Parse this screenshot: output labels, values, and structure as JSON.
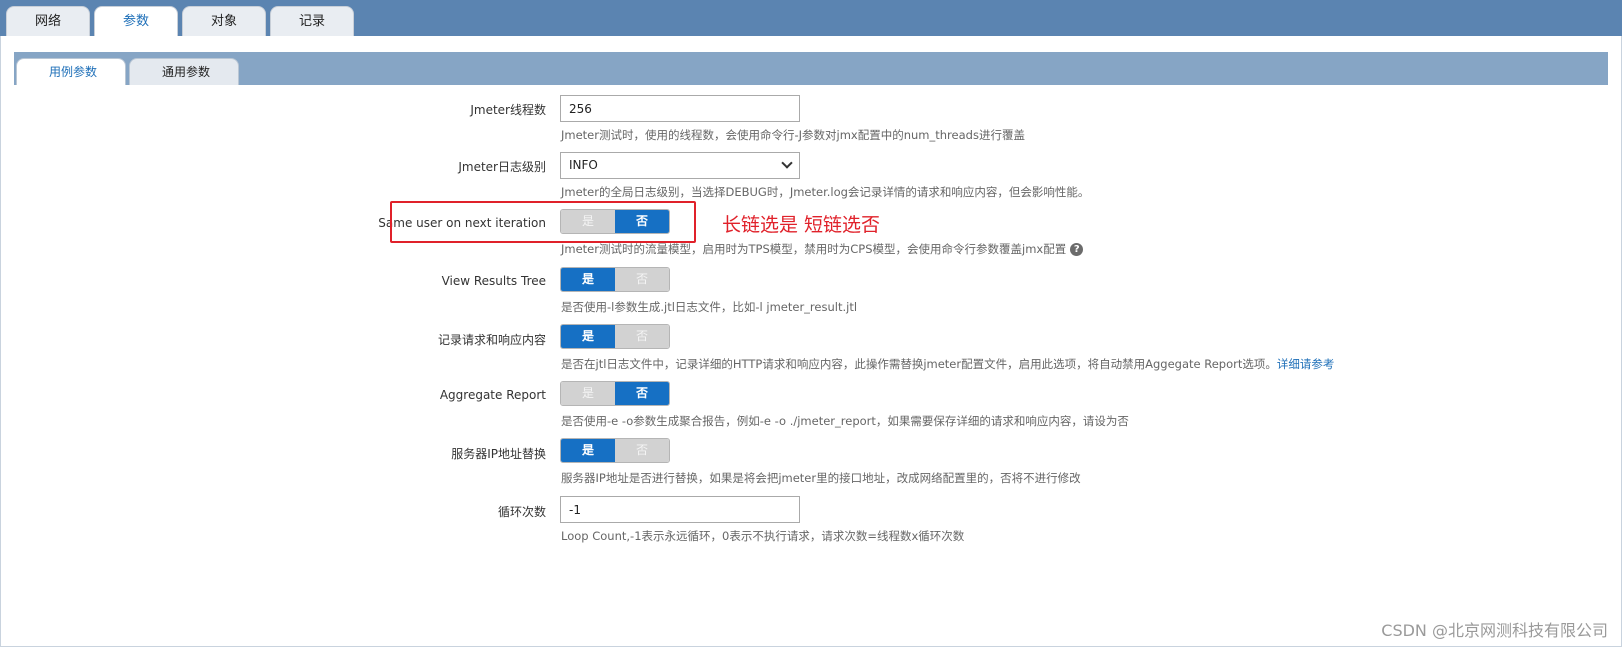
{
  "top_tabs": [
    {
      "label": "网络",
      "active": false
    },
    {
      "label": "参数",
      "active": true
    },
    {
      "label": "对象",
      "active": false
    },
    {
      "label": "记录",
      "active": false
    }
  ],
  "sub_tabs": [
    {
      "label": "用例参数",
      "active": true
    },
    {
      "label": "通用参数",
      "active": false
    }
  ],
  "fields": {
    "threads": {
      "label": "Jmeter线程数",
      "value": "256",
      "help": "Jmeter测试时，使用的线程数，会使用命令行-J参数对jmx配置中的num_threads进行覆盖"
    },
    "log_level": {
      "label": "Jmeter日志级别",
      "value": "INFO",
      "help": "Jmeter的全局日志级别，当选择DEBUG时，Jmeter.log会记录详情的请求和响应内容，但会影响性能。"
    },
    "same_user": {
      "label": "Same user on next iteration",
      "on_label": "是",
      "off_label": "否",
      "selected": "否",
      "help": "Jmeter测试时的流量模型，启用时为TPS模型，禁用时为CPS模型，会使用命令行参数覆盖jmx配置",
      "help_icon": "?"
    },
    "view_results_tree": {
      "label": "View Results Tree",
      "on_label": "是",
      "off_label": "否",
      "selected": "是",
      "help": "是否使用-l参数生成.jtl日志文件，比如-l jmeter_result.jtl"
    },
    "record_content": {
      "label": "记录请求和响应内容",
      "on_label": "是",
      "off_label": "否",
      "selected": "是",
      "help": "是否在jtl日志文件中，记录详细的HTTP请求和响应内容，此操作需替换jmeter配置文件，启用此选项，将自动禁用Aggegate Report选项。",
      "link": "详细请参考"
    },
    "aggregate_report": {
      "label": "Aggregate Report",
      "on_label": "是",
      "off_label": "否",
      "selected": "否",
      "help": "是否使用-e -o参数生成聚合报告，例如-e -o ./jmeter_report，如果需要保存详细的请求和响应内容，请设为否"
    },
    "server_ip": {
      "label": "服务器IP地址替换",
      "on_label": "是",
      "off_label": "否",
      "selected": "是",
      "help": "服务器IP地址是否进行替换，如果是将会把jmeter里的接口地址，改成网络配置里的，否将不进行修改"
    },
    "loop_count": {
      "label": "循环次数",
      "value": "-1",
      "help": "Loop Count,-1表示永远循环，0表示不执行请求，请求次数=线程数x循环次数"
    }
  },
  "annotation": {
    "text": "长链选是 短链选否",
    "color": "#e0212a"
  },
  "watermark": "CSDN @北京网测科技有限公司",
  "colors": {
    "accent": "#1670c4",
    "top_bar": "#5b84b1",
    "sub_bar": "#86a5c5"
  }
}
